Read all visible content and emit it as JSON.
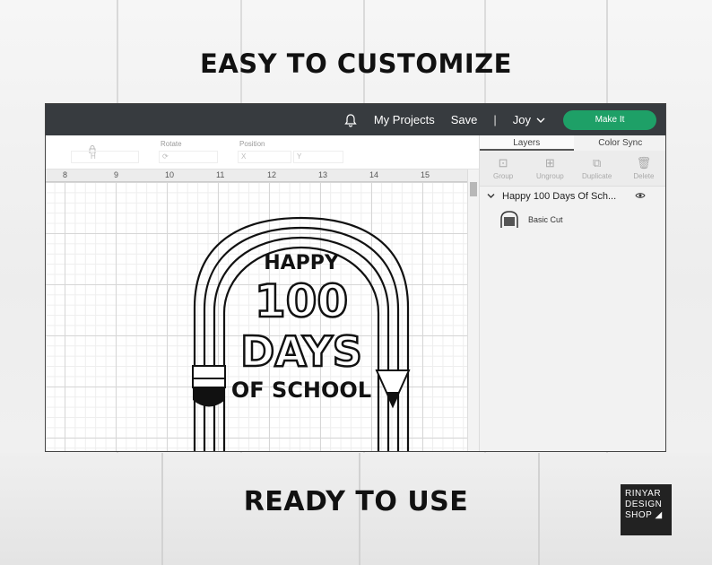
{
  "headlines": {
    "top": "EASY TO CUSTOMIZE",
    "bottom": "READY TO USE"
  },
  "topbar": {
    "projects": "My Projects",
    "save": "Save",
    "divider": "|",
    "user": "Joy",
    "make_it": "Make It",
    "icon": "bell-icon"
  },
  "toolbar": {
    "rotate_label": "Rotate",
    "position_label": "Position",
    "h_label": "H",
    "x_label": "X",
    "y_label": "Y"
  },
  "ruler": {
    "ticks": [
      "8",
      "9",
      "10",
      "11",
      "12",
      "13",
      "14",
      "15"
    ]
  },
  "panel": {
    "tabs": [
      "Layers",
      "Color Sync"
    ],
    "tools": [
      "Group",
      "Ungroup",
      "Duplicate",
      "Delete"
    ],
    "group_name": "Happy 100 Days Of Sch...",
    "layer_name": "Basic Cut"
  },
  "design": {
    "line1": "HAPPY",
    "line2": "100",
    "line3": "DAYS",
    "line4": "OF SCHOOL"
  },
  "brand": {
    "line1": "RINYAR",
    "line2": "DESIGN",
    "line3": "SHOP"
  },
  "colors": {
    "topbar": "#373b3f",
    "make_it": "#1ea067",
    "brand_bg": "#222222"
  }
}
